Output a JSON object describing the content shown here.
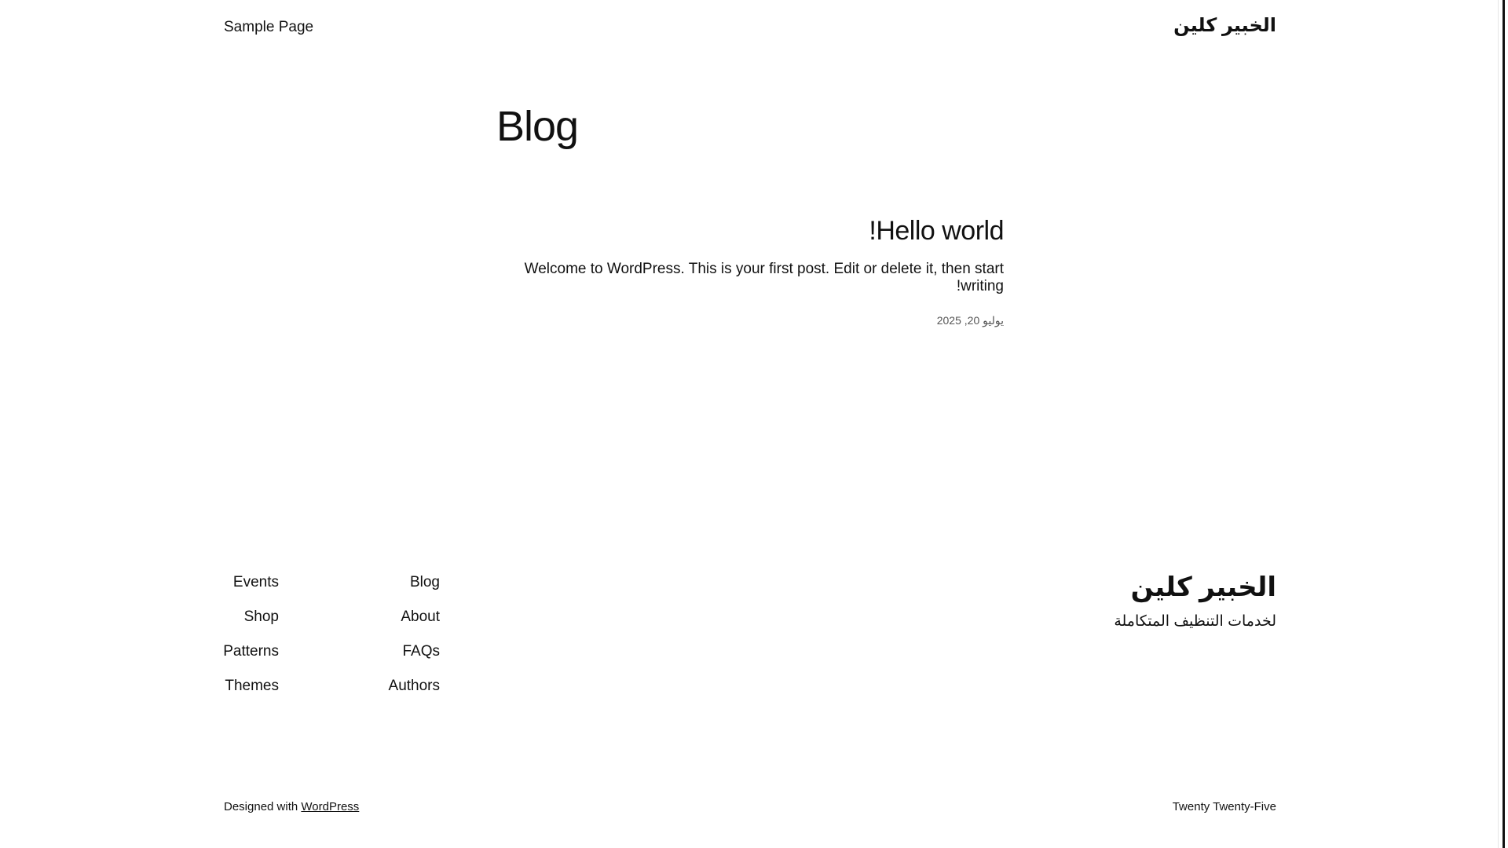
{
  "header": {
    "nav_item": "Sample Page",
    "site_title": "الخبير كلين"
  },
  "main": {
    "heading": "Blog",
    "post": {
      "title": "Hello world!",
      "excerpt": "Welcome to WordPress. This is your first post. Edit or delete it, then start writing!",
      "date": "يوليو 20, 2025"
    }
  },
  "footer": {
    "site_title": "الخبير كلين",
    "tagline": "لخدمات التنظيف المتكاملة",
    "nav_col_1": [
      "Blog",
      "About",
      "FAQs",
      "Authors"
    ],
    "nav_col_2": [
      "Events",
      "Shop",
      "Patterns",
      "Themes"
    ],
    "designed_with_prefix": "Designed with ",
    "designed_with_link": "WordPress",
    "theme_name": "Twenty Twenty-Five"
  },
  "colors": {
    "text": "#111111",
    "background": "#ffffff",
    "muted": "#555555"
  }
}
